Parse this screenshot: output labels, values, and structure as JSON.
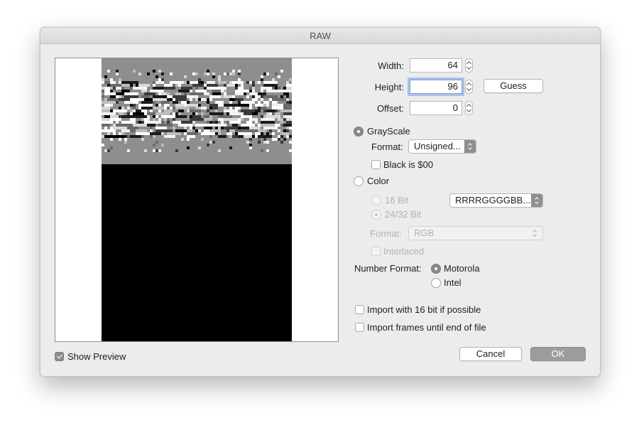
{
  "window": {
    "title": "RAW"
  },
  "dimensions": {
    "width_label": "Width:",
    "width_value": "64",
    "height_label": "Height:",
    "height_value": "96",
    "offset_label": "Offset:",
    "offset_value": "0",
    "guess_label": "Guess"
  },
  "grayscale": {
    "radio_label": "GrayScale",
    "selected": true,
    "format_label": "Format:",
    "format_value": "Unsigned...",
    "black_label": "Black is $00",
    "black_checked": false
  },
  "color": {
    "radio_label": "Color",
    "selected": false,
    "bit16_label": "16 Bit",
    "bit24_label": "24/32 Bit",
    "order_value": "RRRRGGGGBB...",
    "format_label": "Format:",
    "format_value": "RGB",
    "interlaced_label": "Interlaced"
  },
  "number_format": {
    "label": "Number Format:",
    "motorola_label": "Motorola",
    "intel_label": "Intel",
    "selected": "Motorola"
  },
  "options": {
    "import16_label": "Import with 16 bit if possible",
    "frames_label": "Import frames until end of file"
  },
  "preview": {
    "show_label": "Show Preview",
    "checked": true
  },
  "buttons": {
    "cancel": "Cancel",
    "ok": "OK"
  },
  "colors": {
    "window_bg": "#ececec",
    "accent_gray": "#8e8e8e",
    "default_button": "#9c9c9c",
    "focus_ring": "#a9c2e6"
  }
}
